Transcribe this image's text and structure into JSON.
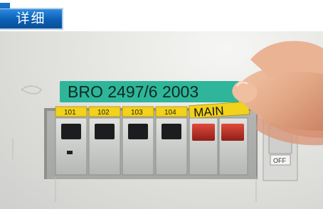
{
  "header": {
    "details_button_label": "详细"
  },
  "photo": {
    "main_label": "BRO 2497/6 2003",
    "circuit_labels": [
      "101",
      "102",
      "103",
      "104"
    ],
    "main_switch_label": "MAIN",
    "off_label": "OFF",
    "colors": {
      "main_label_bg": "#2fb59a",
      "circuit_label_bg": "#f2d21a",
      "main_switch": "#c8352a",
      "panel": "#d8d8d5"
    }
  }
}
